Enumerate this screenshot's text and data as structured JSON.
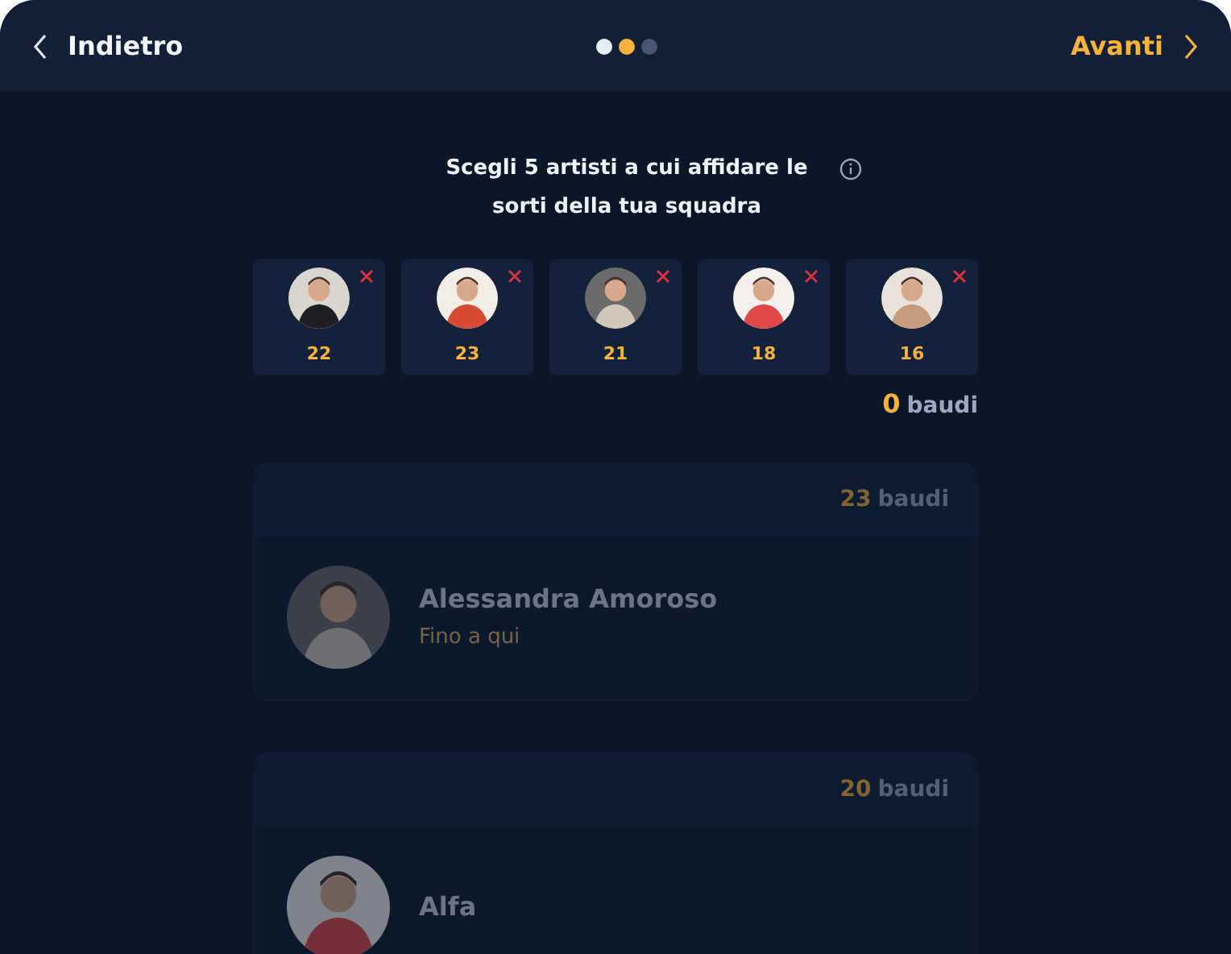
{
  "header": {
    "back": "Indietro",
    "next": "Avanti",
    "steps": [
      {
        "selected": false,
        "completed": true
      },
      {
        "selected": true,
        "completed": false
      },
      {
        "selected": false,
        "completed": false
      }
    ]
  },
  "prompt": "Scegli 5 artisti a cui affidare le sorti della tua squadra",
  "picks": [
    {
      "points": "22"
    },
    {
      "points": "23"
    },
    {
      "points": "21"
    },
    {
      "points": "18"
    },
    {
      "points": "16"
    }
  ],
  "budget": {
    "amount": "0",
    "unit": "baudi"
  },
  "artists": [
    {
      "points": "23",
      "unit": "baudi",
      "name": "Alessandra Amoroso",
      "song": "Fino a qui",
      "disabled": true
    },
    {
      "points": "20",
      "unit": "baudi",
      "name": "Alfa",
      "disabled": true
    }
  ]
}
